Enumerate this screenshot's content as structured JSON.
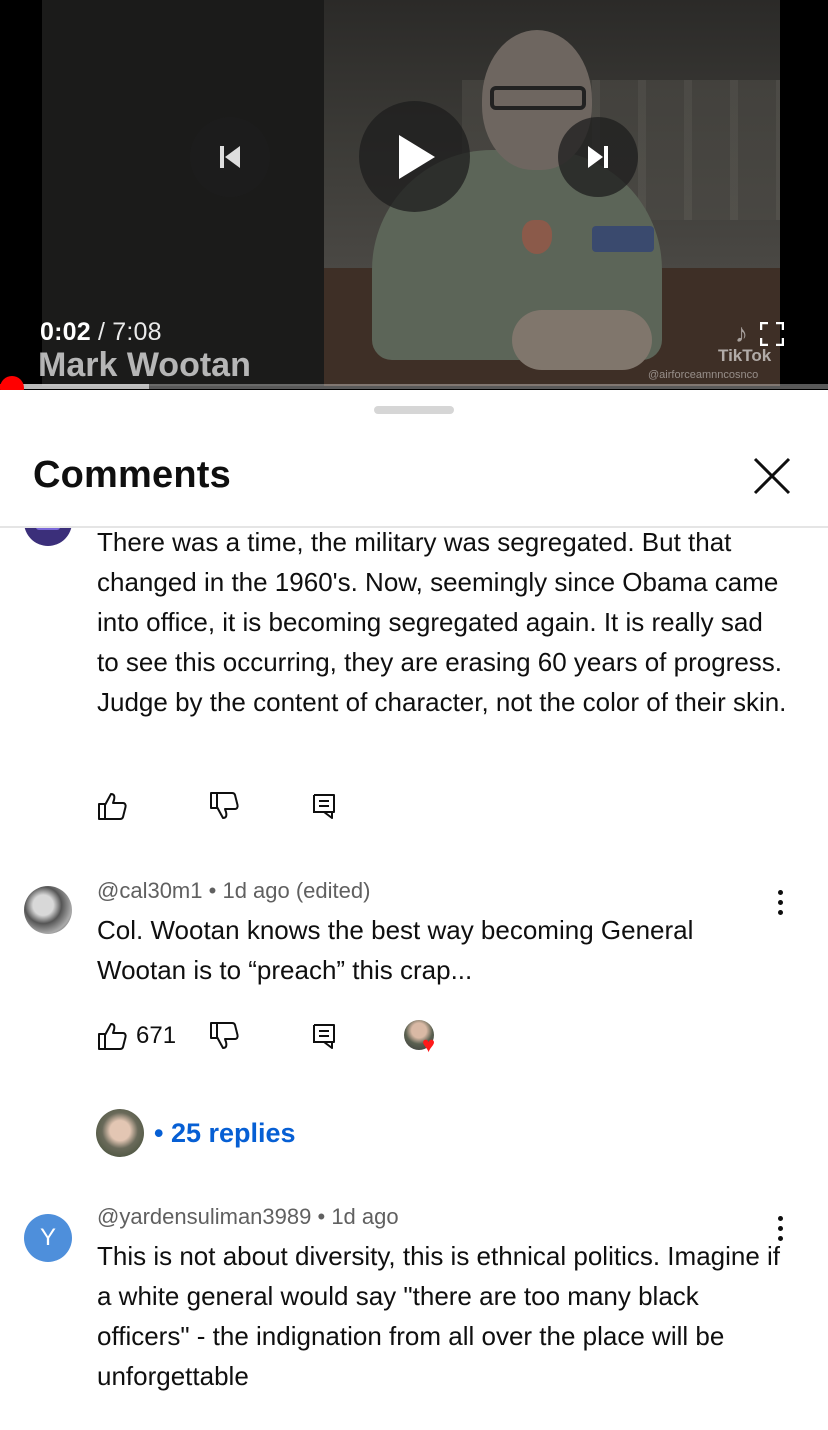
{
  "player": {
    "current_time": "0:02",
    "separator": " / ",
    "duration": "7:08",
    "caption_name": "Mark Wootan",
    "watermark": "TikTok",
    "watermark_handle": "@airforceamnncosnco",
    "progress_fraction": 0.005,
    "buffered_fraction": 0.18,
    "icons": [
      "previous-icon",
      "play-icon",
      "next-icon",
      "fullscreen-icon"
    ]
  },
  "comments": {
    "title": "Comments",
    "items": [
      {
        "author": "",
        "time": "",
        "text": "There was a time, the military was segregated.  But that changed in the 1960's.  Now, seemingly since Obama came into office,  it is becoming segregated again.   It is really sad to see this occurring, they are erasing 60 years of progress.  Judge by the content of character, not the color of their skin.",
        "likes": ""
      },
      {
        "author": "@cal30m1",
        "time": "1d ago (edited)",
        "text": "Col. Wootan knows the best way becoming General Wootan is to “preach” this crap...",
        "likes": "671",
        "creator_hearted": true,
        "replies": "25 replies"
      },
      {
        "author": "@yardensuliman3989",
        "time": "1d ago",
        "avatar_letter": "Y",
        "text": "This is not about diversity, this is ethnical politics. Imagine if a white general would say \"there are too many black officers\" - the indignation from all over the place will be unforgettable"
      }
    ]
  },
  "colors": {
    "accent_red": "#ff0000",
    "link_blue": "#065fd4",
    "avatar_y": "#4e8fdb"
  }
}
